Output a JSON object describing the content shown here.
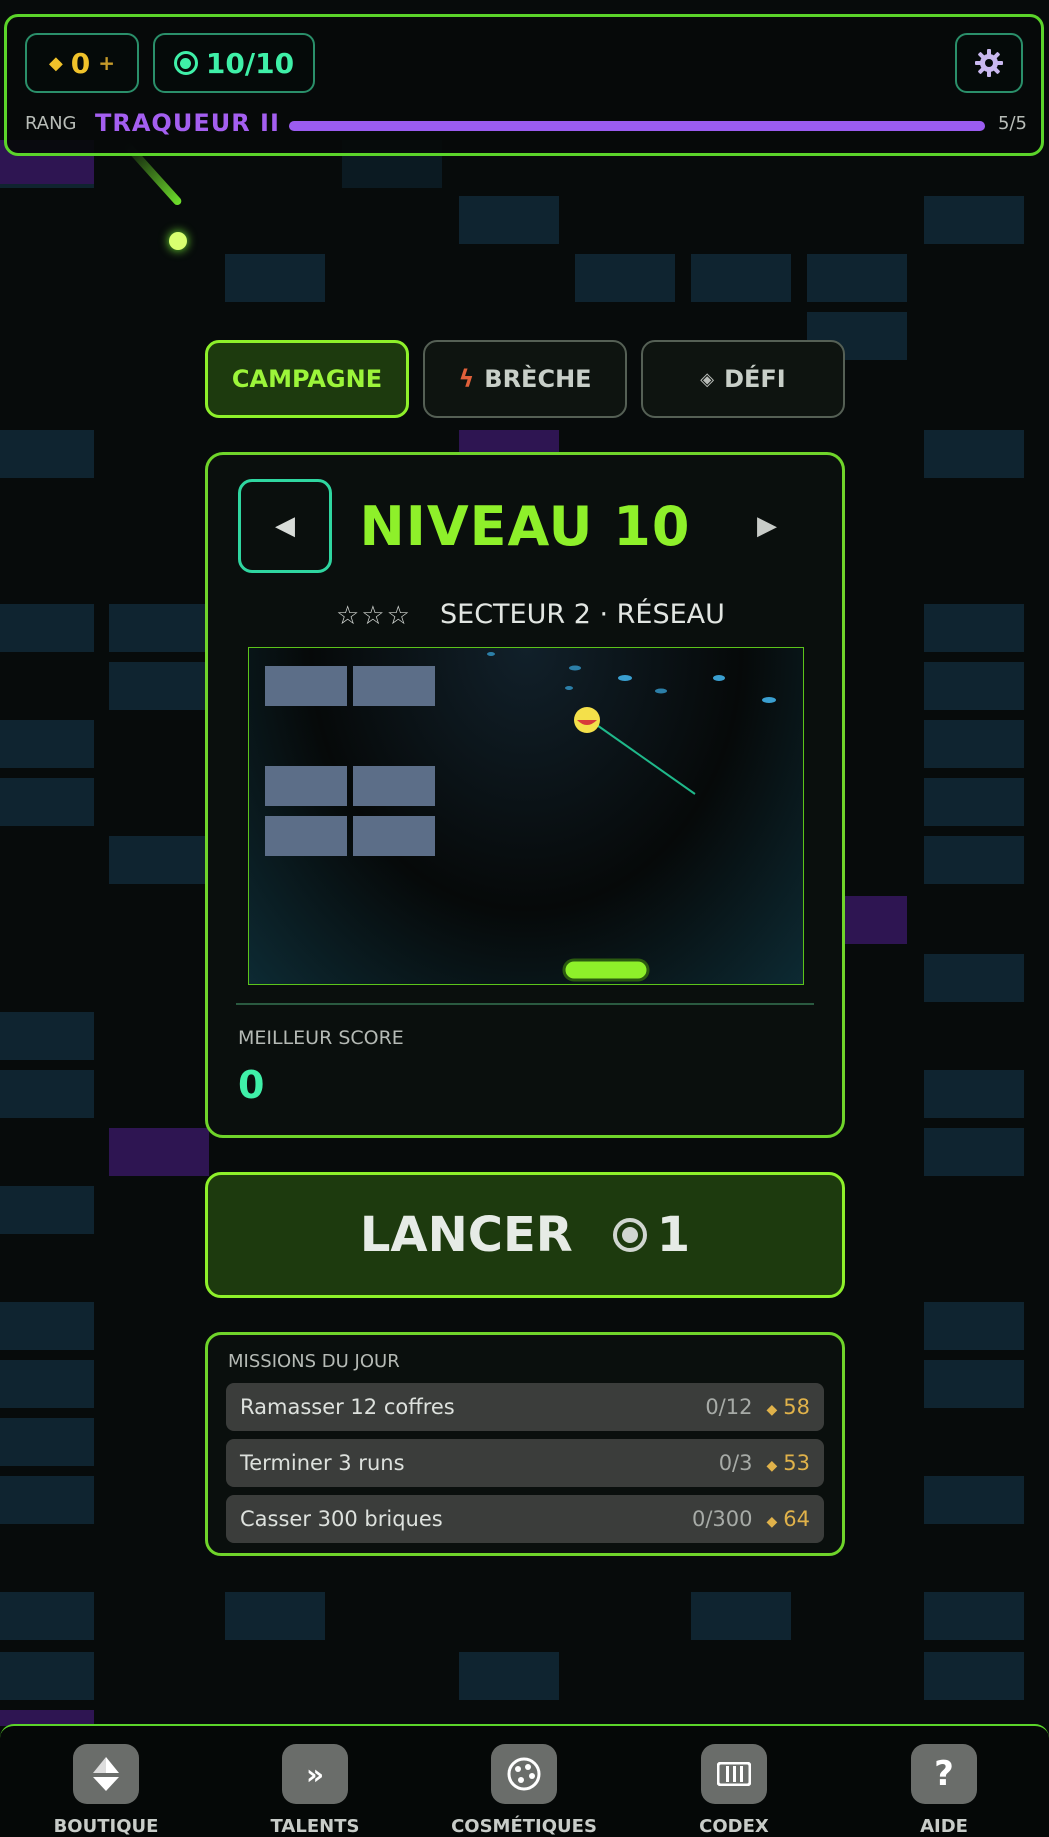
{
  "header": {
    "coins": "0",
    "coins_plus": "+",
    "energy": "10/10",
    "rank_label": "RANG",
    "rank_name": "TRAQUEUR II",
    "rank_progress": "5/5",
    "rank_fill_fraction": 1.0,
    "settings_icon": "gear-icon"
  },
  "tabs": [
    {
      "label": "CAMPAGNE",
      "active": true,
      "icon": null
    },
    {
      "label": "BRÈCHE",
      "active": false,
      "icon": "lightning-icon"
    },
    {
      "label": "DÉFI",
      "active": false,
      "icon": "diamond-icon"
    }
  ],
  "level": {
    "title": "NIVEAU 10",
    "stars": "☆☆☆",
    "sector": "SECTEUR 2 · RÉSEAU",
    "prev_arrow": "◀",
    "next_arrow": "▶",
    "best_score_label": "MEILLEUR SCORE",
    "best_score_value": "0"
  },
  "launch": {
    "label": "LANCER",
    "cost": "1"
  },
  "missions": {
    "title": "MISSIONS DU JOUR",
    "items": [
      {
        "label": "Ramasser 12 coffres",
        "progress": "0/12",
        "reward": "58"
      },
      {
        "label": "Terminer 3 runs",
        "progress": "0/3",
        "reward": "53"
      },
      {
        "label": "Casser 300 briques",
        "progress": "0/300",
        "reward": "64"
      }
    ]
  },
  "nav": [
    {
      "label": "BOUTIQUE",
      "icon": "shop-icon",
      "glyph": ""
    },
    {
      "label": "TALENTS",
      "icon": "talents-icon",
      "glyph": "»"
    },
    {
      "label": "COSMÉTIQUES",
      "icon": "palette-icon",
      "glyph": ""
    },
    {
      "label": "CODEX",
      "icon": "codex-icon",
      "glyph": ""
    },
    {
      "label": "AIDE",
      "icon": "help-icon",
      "glyph": "?"
    }
  ],
  "colors": {
    "accent": "#8ef02a",
    "teal": "#3ff0a8",
    "rank_purple": "#9b5cf0",
    "gold": "#e0b24a"
  }
}
